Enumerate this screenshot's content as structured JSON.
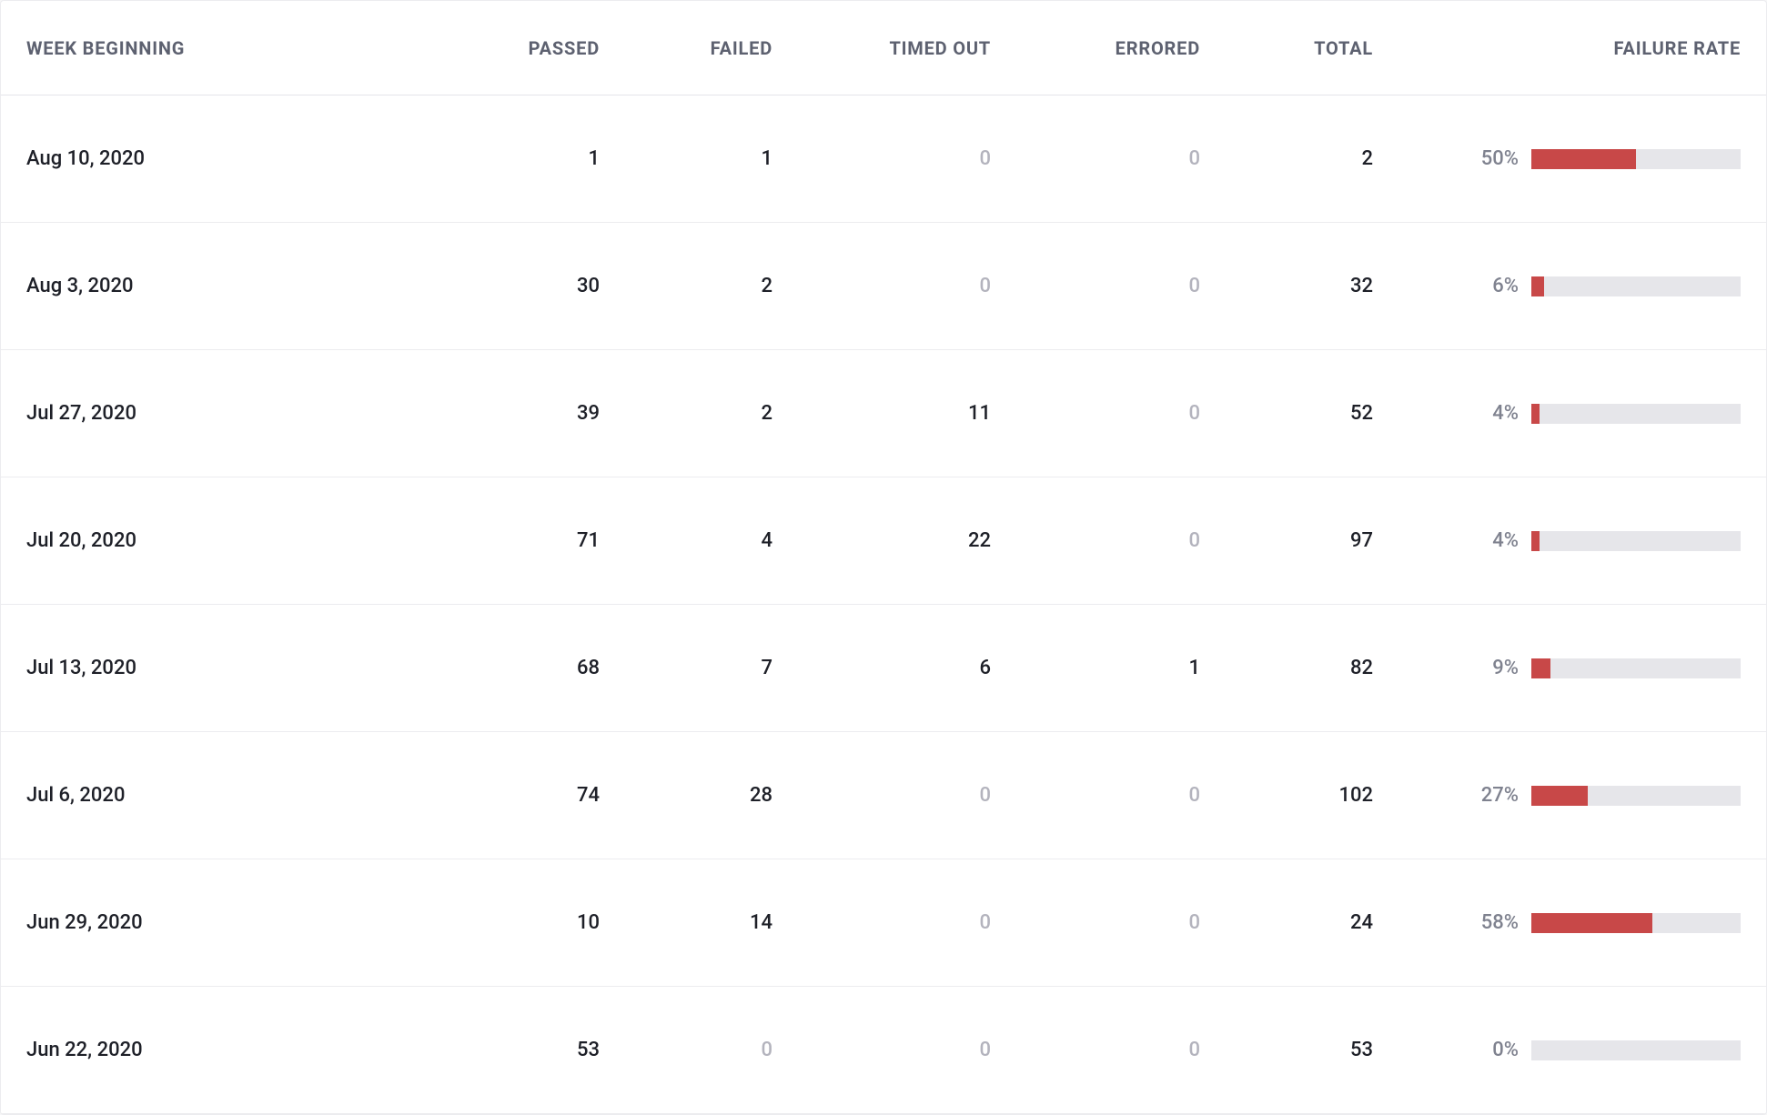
{
  "columns": {
    "week": "Week Beginning",
    "passed": "Passed",
    "failed": "Failed",
    "timed_out": "Timed Out",
    "errored": "Errored",
    "total": "Total",
    "failure_rate": "Failure Rate"
  },
  "colors": {
    "bar_bg": "#e6e6ea",
    "bar_fill": "#c84848",
    "muted": "#b3b3bd"
  },
  "rows": [
    {
      "week": "Aug 10, 2020",
      "passed": "1",
      "failed": "1",
      "timed_out": "0",
      "errored": "0",
      "total": "2",
      "rate_label": "50%",
      "rate_pct": 50
    },
    {
      "week": "Aug 3, 2020",
      "passed": "30",
      "failed": "2",
      "timed_out": "0",
      "errored": "0",
      "total": "32",
      "rate_label": "6%",
      "rate_pct": 6
    },
    {
      "week": "Jul 27, 2020",
      "passed": "39",
      "failed": "2",
      "timed_out": "11",
      "errored": "0",
      "total": "52",
      "rate_label": "4%",
      "rate_pct": 4
    },
    {
      "week": "Jul 20, 2020",
      "passed": "71",
      "failed": "4",
      "timed_out": "22",
      "errored": "0",
      "total": "97",
      "rate_label": "4%",
      "rate_pct": 4
    },
    {
      "week": "Jul 13, 2020",
      "passed": "68",
      "failed": "7",
      "timed_out": "6",
      "errored": "1",
      "total": "82",
      "rate_label": "9%",
      "rate_pct": 9
    },
    {
      "week": "Jul 6, 2020",
      "passed": "74",
      "failed": "28",
      "timed_out": "0",
      "errored": "0",
      "total": "102",
      "rate_label": "27%",
      "rate_pct": 27
    },
    {
      "week": "Jun 29, 2020",
      "passed": "10",
      "failed": "14",
      "timed_out": "0",
      "errored": "0",
      "total": "24",
      "rate_label": "58%",
      "rate_pct": 58
    },
    {
      "week": "Jun 22, 2020",
      "passed": "53",
      "failed": "0",
      "timed_out": "0",
      "errored": "0",
      "total": "53",
      "rate_label": "0%",
      "rate_pct": 0
    }
  ]
}
